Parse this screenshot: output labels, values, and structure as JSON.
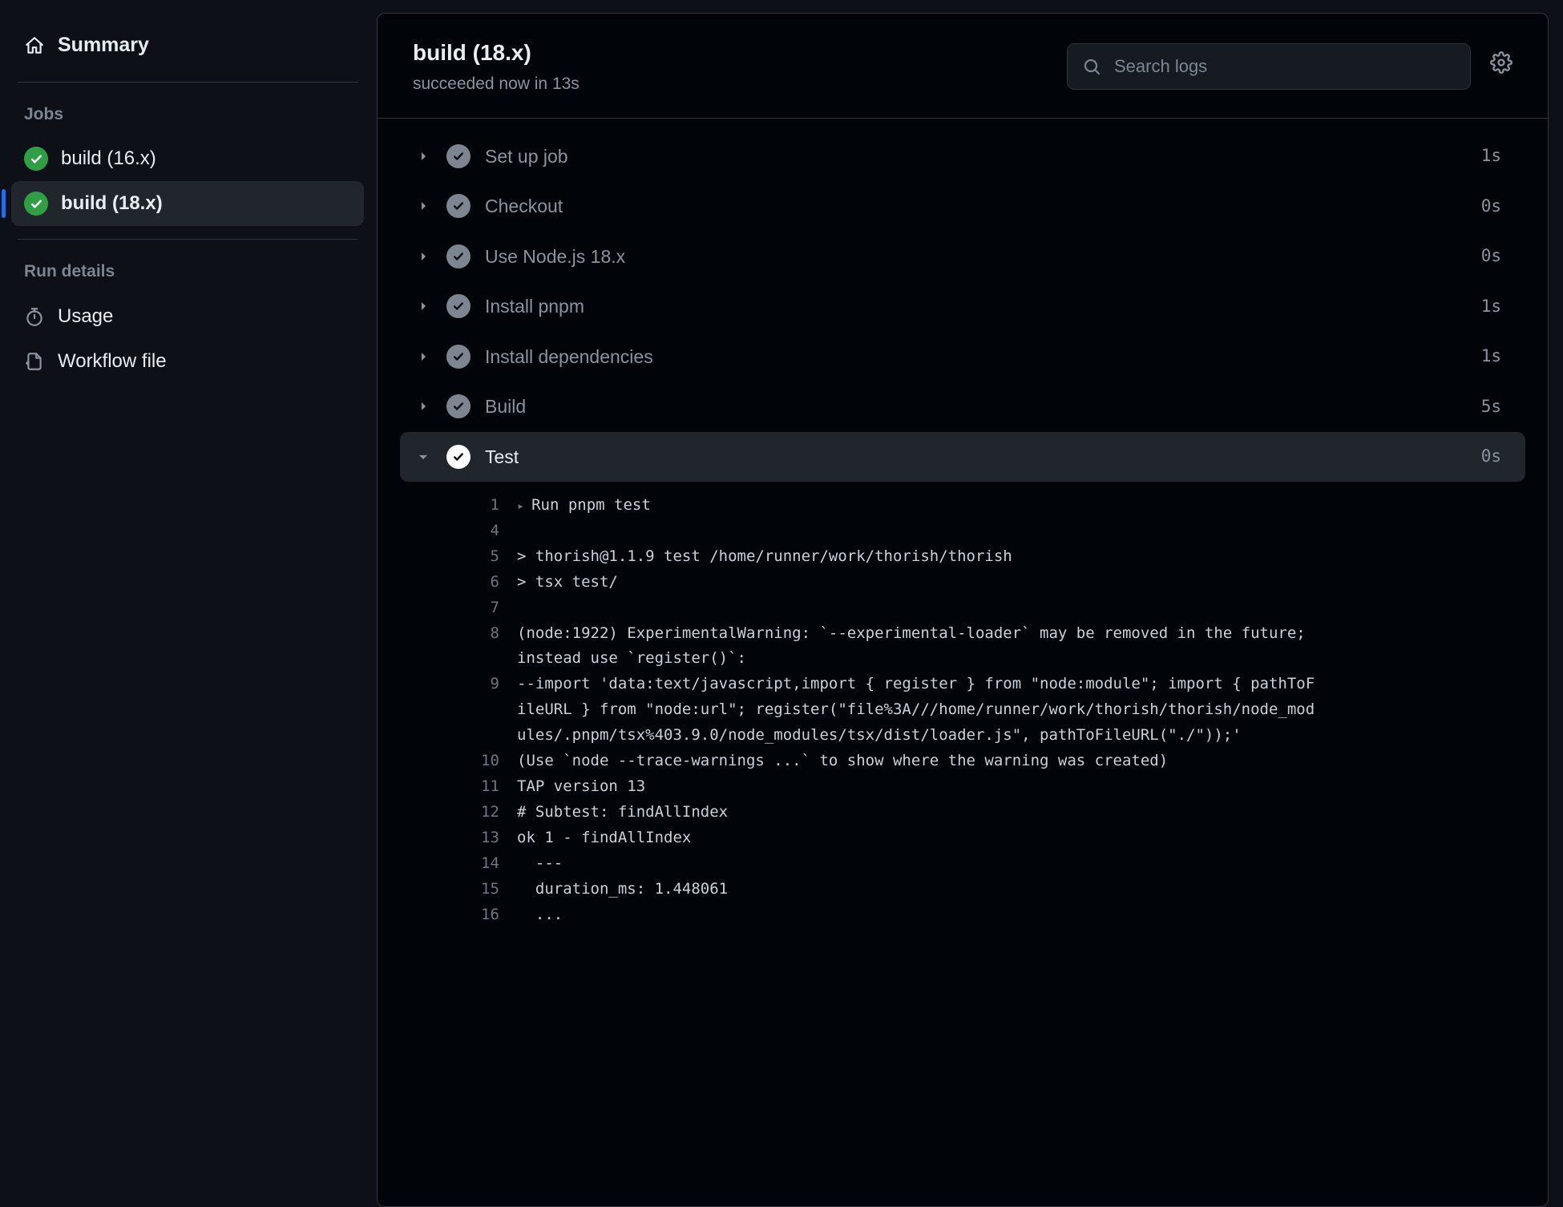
{
  "sidebar": {
    "summary_label": "Summary",
    "jobs_heading": "Jobs",
    "jobs": [
      {
        "label": "build (16.x)",
        "active": false
      },
      {
        "label": "build (18.x)",
        "active": true
      }
    ],
    "run_details_heading": "Run details",
    "run_details": [
      {
        "label": "Usage",
        "icon": "stopwatch"
      },
      {
        "label": "Workflow file",
        "icon": "workflow-file"
      }
    ]
  },
  "header": {
    "title": "build (18.x)",
    "subtitle": "succeeded now in 13s",
    "search_placeholder": "Search logs"
  },
  "steps": [
    {
      "name": "Set up job",
      "duration": "1s",
      "expanded": false
    },
    {
      "name": "Checkout",
      "duration": "0s",
      "expanded": false
    },
    {
      "name": "Use Node.js 18.x",
      "duration": "0s",
      "expanded": false
    },
    {
      "name": "Install pnpm",
      "duration": "1s",
      "expanded": false
    },
    {
      "name": "Install dependencies",
      "duration": "1s",
      "expanded": false
    },
    {
      "name": "Build",
      "duration": "5s",
      "expanded": false
    },
    {
      "name": "Test",
      "duration": "0s",
      "expanded": true
    }
  ],
  "log": [
    {
      "n": "1",
      "t": "Run pnpm test",
      "fold": true
    },
    {
      "n": "4",
      "t": ""
    },
    {
      "n": "5",
      "t": "> thorish@1.1.9 test /home/runner/work/thorish/thorish"
    },
    {
      "n": "6",
      "t": "> tsx test/"
    },
    {
      "n": "7",
      "t": ""
    },
    {
      "n": "8",
      "t": "(node:1922) ExperimentalWarning: `--experimental-loader` may be removed in the future; instead use `register()`:"
    },
    {
      "n": "9",
      "t": "--import 'data:text/javascript,import { register } from \"node:module\"; import { pathToFileURL } from \"node:url\"; register(\"file%3A///home/runner/work/thorish/thorish/node_modules/.pnpm/tsx%403.9.0/node_modules/tsx/dist/loader.js\", pathToFileURL(\"./\"));'"
    },
    {
      "n": "10",
      "t": "(Use `node --trace-warnings ...` to show where the warning was created)"
    },
    {
      "n": "11",
      "t": "TAP version 13"
    },
    {
      "n": "12",
      "t": "# Subtest: findAllIndex"
    },
    {
      "n": "13",
      "t": "ok 1 - findAllIndex"
    },
    {
      "n": "14",
      "t": "  ---"
    },
    {
      "n": "15",
      "t": "  duration_ms: 1.448061"
    },
    {
      "n": "16",
      "t": "  ..."
    }
  ]
}
